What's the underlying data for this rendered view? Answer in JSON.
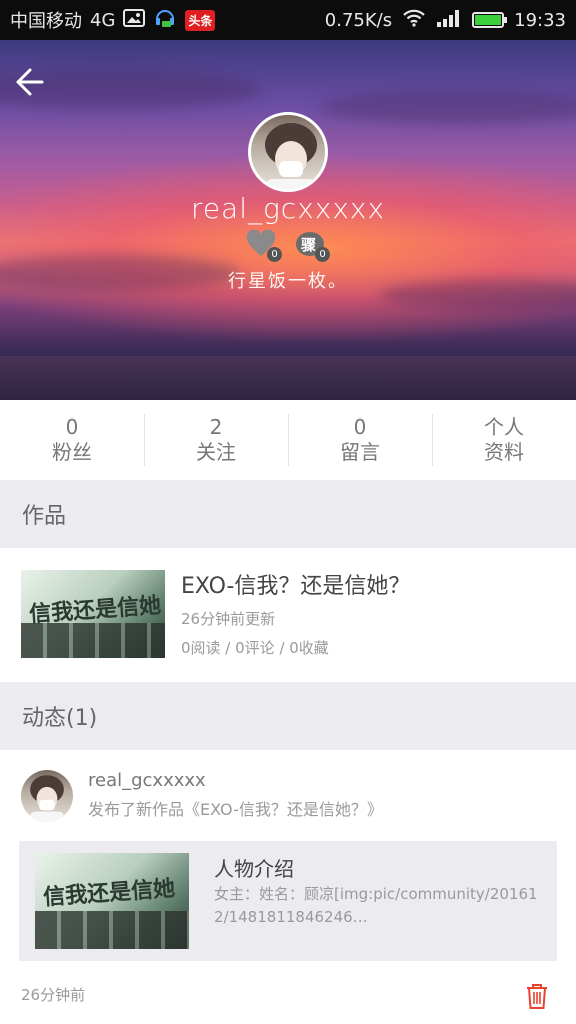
{
  "status_bar": {
    "carrier": "中国移动",
    "network": "4G",
    "app_badge": "头条",
    "speed": "0.75K/s",
    "time": "19:33"
  },
  "profile": {
    "username": "real_gcxxxxx",
    "likes_count": "0",
    "medal_count": "0",
    "medal_glyph": "骤",
    "tagline": "行星饭一枚。"
  },
  "stats": [
    {
      "value": "0",
      "label": "粉丝"
    },
    {
      "value": "2",
      "label": "关注"
    },
    {
      "value": "0",
      "label": "留言"
    },
    {
      "value": "个人",
      "label": "资料"
    }
  ],
  "works_section": {
    "title": "作品",
    "item": {
      "thumb_text": "信我还是信她",
      "title": "EXO-信我？还是信她？",
      "updated": "26分钟前更新",
      "stats": "0阅读 / 0评论 / 0收藏"
    }
  },
  "feed_section": {
    "title": "动态(1)",
    "item": {
      "user": "real_gcxxxxx",
      "action": "发布了新作品《EXO-信我？还是信她？》",
      "card_title": "人物介绍",
      "card_desc": "女主：姓名：顾凉[img:pic/community/201612/1481811846246…",
      "time": "26分钟前"
    }
  },
  "colors": {
    "accent_delete": "#e8432f",
    "section_bg": "#ececf0"
  }
}
